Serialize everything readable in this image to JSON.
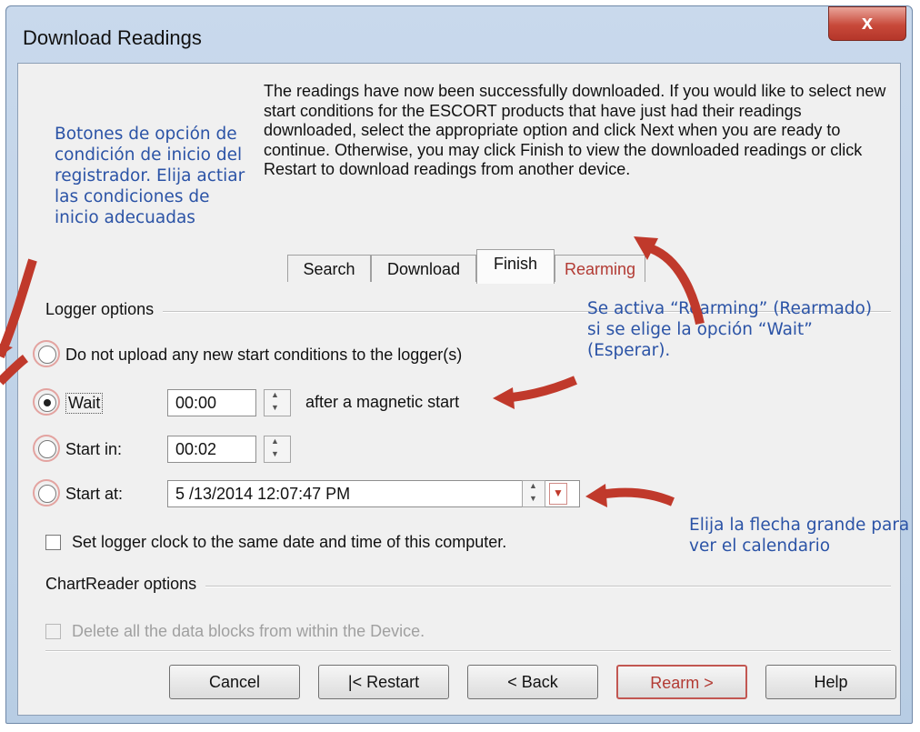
{
  "window": {
    "title": "Download Readings",
    "close_glyph": "x"
  },
  "intro": "The readings have now been successfully downloaded. If you would like to select new start conditions for the ESCORT products that have just had their readings downloaded, select the appropriate option and click Next when you are ready to continue. Otherwise, you may click Finish to view the downloaded readings or click Restart to download readings from another device.",
  "annotations": {
    "left": "Botones de opción de condición de inicio del registrador. Elija actiar las condiciones de inicio adecuadas",
    "rearming": "Se activa “Rearming” (Rearmado) si se elige la opción “Wait” (Esperar).",
    "calendar": "Elija la flecha grande para ver el calendario"
  },
  "tabs": [
    "Search",
    "Download",
    "Finish",
    "Rearming"
  ],
  "logger_options": {
    "label": "Logger options",
    "no_upload": "Do not upload any new start conditions to the logger(s)",
    "wait_label": "Wait",
    "wait_value": "00:00",
    "wait_suffix": "after a magnetic start",
    "start_in_label": "Start in:",
    "start_in_value": "00:02",
    "start_at_label": "Start at:",
    "start_at_value": "5 /13/2014  12:07:47 PM",
    "clock_sync": "Set logger clock to the same date and time of this computer."
  },
  "chartreader_options": {
    "label": "ChartReader options",
    "delete_blocks": "Delete all the data blocks from within the Device."
  },
  "buttons": {
    "cancel": "Cancel",
    "restart": "|< Restart",
    "back": "< Back",
    "rearm": "Rearm >",
    "help": "Help"
  },
  "colors": {
    "annotation": "#2b53a6",
    "arrow": "#c0392b",
    "accent_red": "#b23a33"
  }
}
